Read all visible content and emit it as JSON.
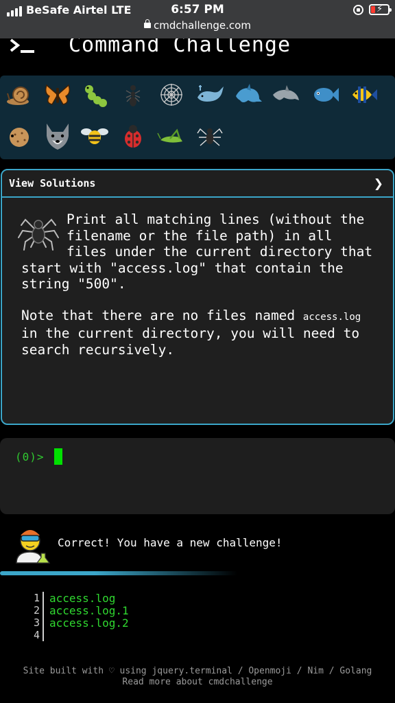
{
  "status_bar": {
    "carrier": "BeSafe Airtel  LTE",
    "time": "6:57 PM",
    "url": "cmdchallenge.com"
  },
  "header": {
    "title": "Command Challenge"
  },
  "emoji_tray": {
    "row1": [
      "snail-icon",
      "butterfly-icon",
      "caterpillar-icon",
      "ant-icon",
      "spider-web-icon",
      "whale-icon",
      "dolphin-icon",
      "dolphin-gray-icon",
      "fish-icon",
      "tropical-fish-icon"
    ],
    "row2": [
      "blowfish-icon",
      "wolf-icon",
      "bee-icon",
      "ladybug-icon",
      "cricket-icon",
      "spider-icon"
    ]
  },
  "solutions": {
    "header_label": "View Solutions",
    "chevron": "❯",
    "challenge_text_1": "Print all matching lines (without the filename or the file path) in all files under the current directory that start with \"access.log\" that contain the string \"500\".",
    "note_pre": "Note that there are no files named ",
    "note_code": "access.log",
    "note_post": " in the current directory, you will need to search recursively."
  },
  "terminal": {
    "prompt": "(0)>"
  },
  "result": {
    "message": "Correct! You have a new challenge!"
  },
  "files": {
    "lines": [
      {
        "num": "1",
        "name": "access.log"
      },
      {
        "num": "2",
        "name": "access.log.1"
      },
      {
        "num": "3",
        "name": "access.log.2"
      },
      {
        "num": "4",
        "name": ""
      }
    ]
  },
  "footer": {
    "line1": "Site built with ♡ using jquery.terminal / Openmoji / Nim / Golang",
    "line2": "Read more about cmdchallenge"
  },
  "colors": {
    "accent": "#3ba6c9",
    "prompt_green": "#30c930",
    "cursor_green": "#00e000",
    "tray_bg": "#0f2a38",
    "card_bg": "#1f1f1f"
  }
}
